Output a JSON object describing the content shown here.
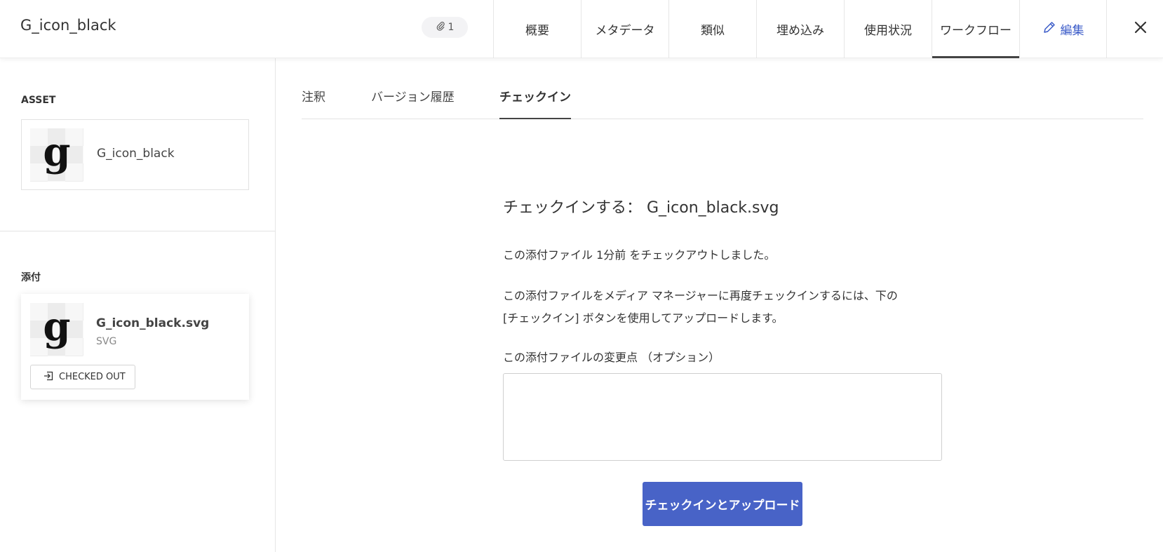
{
  "header": {
    "title": "G_icon_black",
    "attachment_count": "1",
    "tabs": [
      {
        "label": "概要"
      },
      {
        "label": "メタデータ"
      },
      {
        "label": "類似"
      },
      {
        "label": "埋め込み"
      },
      {
        "label": "使用状況"
      },
      {
        "label": "ワークフロー",
        "active": true
      }
    ],
    "edit_label": "編集",
    "accent_color": "#3b5bc8"
  },
  "sidebar": {
    "asset_label": "ASSET",
    "asset_name": "G_icon_black",
    "thumb_glyph": "g",
    "attachments_label": "添付",
    "attachment": {
      "file_name": "G_icon_black.svg",
      "file_type": "SVG",
      "status_button": "CHECKED OUT"
    }
  },
  "main": {
    "subtabs": [
      {
        "label": "注釈"
      },
      {
        "label": "バージョン履歴"
      },
      {
        "label": "チェックイン",
        "active": true
      }
    ],
    "checkin_title": "チェックインする： G_icon_black.svg",
    "checked_out_msg": "この添付ファイル 1分前 をチェックアウトしました。",
    "instruction_line1": "この添付ファイルをメディア マネージャーに再度チェックインするには、下の",
    "instruction_line2": "[チェックイン] ボタンを使用してアップロードします。",
    "changes_label": "この添付ファイルの変更点 （オプション）",
    "changes_value": "",
    "submit_label": "チェックインとアップロード",
    "button_color": "#4863c7"
  }
}
